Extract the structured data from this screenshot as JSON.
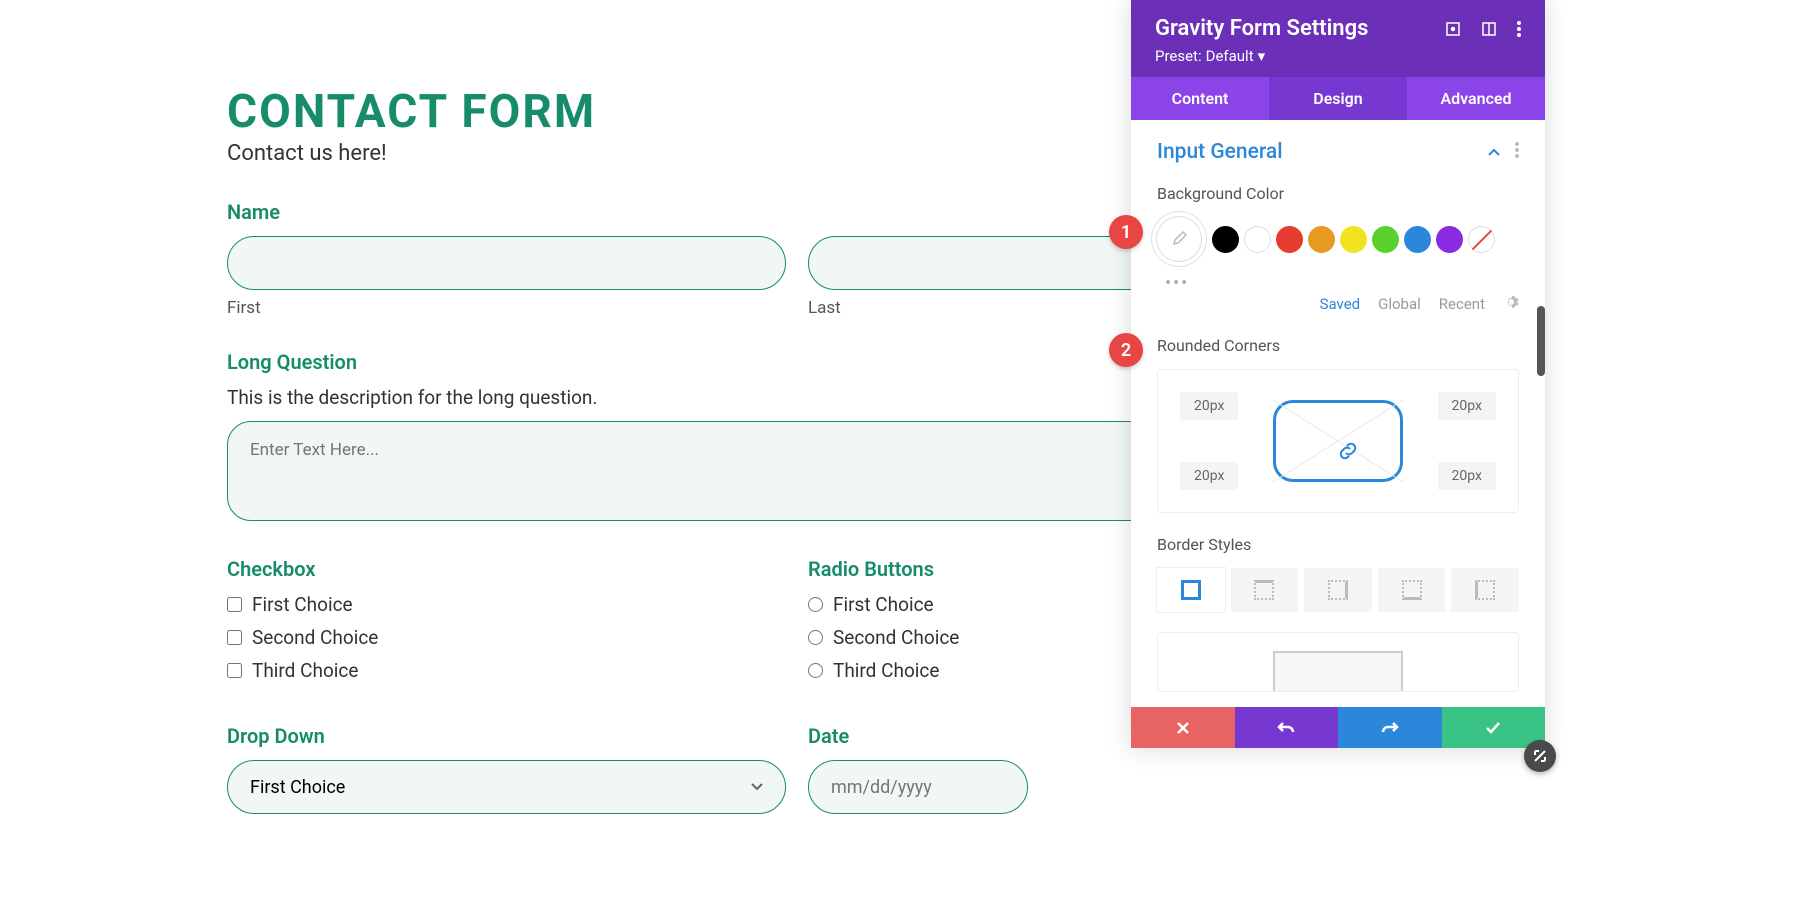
{
  "form": {
    "title": "CONTACT FORM",
    "subtitle": "Contact us here!",
    "name_label": "Name",
    "first_label": "First",
    "last_label": "Last",
    "longq_label": "Long Question",
    "longq_desc": "This is the description for the long question.",
    "longq_placeholder": "Enter Text Here...",
    "checkbox_label": "Checkbox",
    "radio_label": "Radio Buttons",
    "choices": [
      "First Choice",
      "Second Choice",
      "Third Choice"
    ],
    "dropdown_label": "Drop Down",
    "dropdown_value": "First Choice",
    "date_label": "Date",
    "date_placeholder": "mm/dd/yyyy"
  },
  "panel": {
    "title": "Gravity Form Settings",
    "preset_label": "Preset:",
    "preset_value": "Default",
    "tabs": {
      "content": "Content",
      "design": "Design",
      "advanced": "Advanced"
    },
    "section": "Input General",
    "bg_label": "Background Color",
    "swatches": [
      "#000000",
      "#ffffff",
      "#e63b2e",
      "#e69a1f",
      "#f2e21f",
      "#5bd12e",
      "#2b87da",
      "#8a2be2"
    ],
    "color_tabs": {
      "saved": "Saved",
      "global": "Global",
      "recent": "Recent"
    },
    "corners_label": "Rounded Corners",
    "corner_value": "20px",
    "border_label": "Border Styles"
  },
  "badges": {
    "one": "1",
    "two": "2"
  }
}
